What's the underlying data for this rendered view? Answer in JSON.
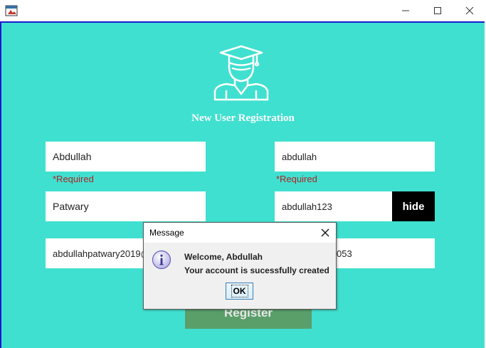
{
  "window": {
    "title": ""
  },
  "form": {
    "heading": "New User Registration",
    "first_name": "Abdullah",
    "last_name": "Patwary",
    "email": "abdullahpatwary2019@",
    "username": "abdullah",
    "password": "abdullah123",
    "phone_visible_suffix": "053",
    "required_label": "*Required",
    "hide_label": "hide",
    "register_label": "Register"
  },
  "dialog": {
    "title": "Message",
    "line1": "Welcome, Abdullah",
    "line2": "Your account is sucessfully created",
    "ok_label": "OK"
  },
  "colors": {
    "background": "#40E0D0",
    "required": "#b22222",
    "hide_button": "#000000",
    "register_button": "#5a9f6a"
  },
  "icons": [
    "app-icon",
    "minimize-icon",
    "maximize-icon",
    "close-icon",
    "graduate-icon",
    "info-icon",
    "dialog-close-icon"
  ]
}
